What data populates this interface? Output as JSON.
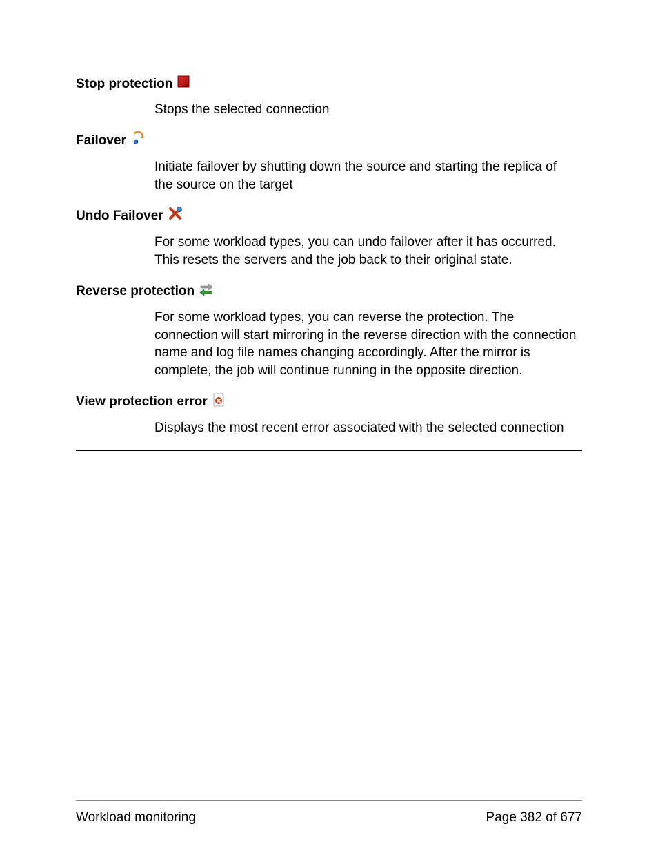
{
  "entries": [
    {
      "title": "Stop protection",
      "desc": "Stops the selected connection"
    },
    {
      "title": "Failover",
      "desc": "Initiate failover by shutting down the source and starting the replica of the source on the target"
    },
    {
      "title": "Undo Failover",
      "desc": "For some workload types, you can undo failover after it has occurred. This resets the servers and the job back to their original state."
    },
    {
      "title": "Reverse protection",
      "desc": "For some workload types, you can reverse the protection. The connection will start mirroring in the reverse direction with the connection name and log file names changing accordingly. After the mirror is complete, the job will continue running in the opposite direction."
    },
    {
      "title": "View protection error",
      "desc": "Displays the most recent error associated with the selected connection"
    }
  ],
  "footer": {
    "left": "Workload monitoring",
    "right": "Page 382 of 677"
  }
}
